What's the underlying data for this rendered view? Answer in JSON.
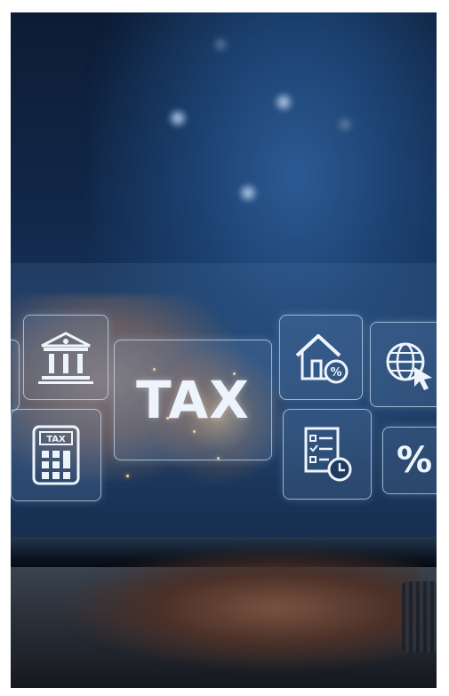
{
  "photo": {
    "subject": "",
    "tiles": [
      {
        "icon": "bank-building-icon"
      },
      {
        "icon": "calculator-icon",
        "label": "TAX"
      },
      {
        "icon": "tax-text",
        "label": "TAX"
      },
      {
        "icon": "house-percent-icon"
      },
      {
        "icon": "globe-cursor-icon"
      },
      {
        "icon": "checklist-clock-icon"
      },
      {
        "icon": "percent-icon",
        "label": "%"
      }
    ]
  }
}
